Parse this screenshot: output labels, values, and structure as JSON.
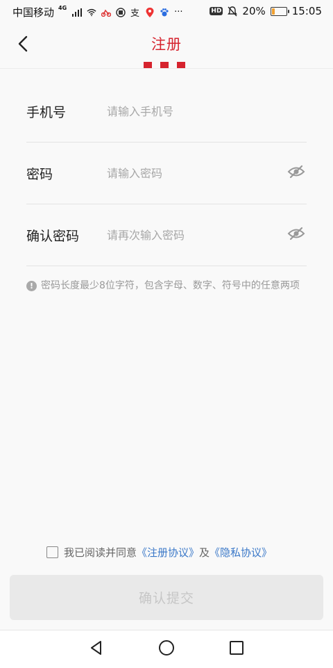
{
  "status_bar": {
    "carrier": "中国移动",
    "network": "4G",
    "battery": "20%",
    "battery_level": 0.2,
    "time": "15:05",
    "hd_badge": "HD",
    "more": "···"
  },
  "header": {
    "title": "注册",
    "back_icon": "chevron-left-icon",
    "accent_color": "#d6232e"
  },
  "form": {
    "phone": {
      "label": "手机号",
      "placeholder": "请输入手机号"
    },
    "password": {
      "label": "密码",
      "placeholder": "请输入密码",
      "toggle_icon": "eye-off-icon"
    },
    "confirm_password": {
      "label": "确认密码",
      "placeholder": "请再次输入密码",
      "toggle_icon": "eye-off-icon"
    }
  },
  "hint": {
    "icon_text": "!",
    "text": "密码长度最少8位字符，包含字母、数字、符号中的任意两项"
  },
  "agreement": {
    "prefix": "我已阅读并同意",
    "register_link": "《注册协议》",
    "joiner": "及",
    "privacy_link": "《隐私协议》",
    "link_color": "#3a78c8"
  },
  "submit": {
    "label": "确认提交"
  },
  "nav": {
    "back_icon": "nav-back-icon",
    "home_icon": "nav-home-icon",
    "recents_icon": "nav-recents-icon"
  }
}
